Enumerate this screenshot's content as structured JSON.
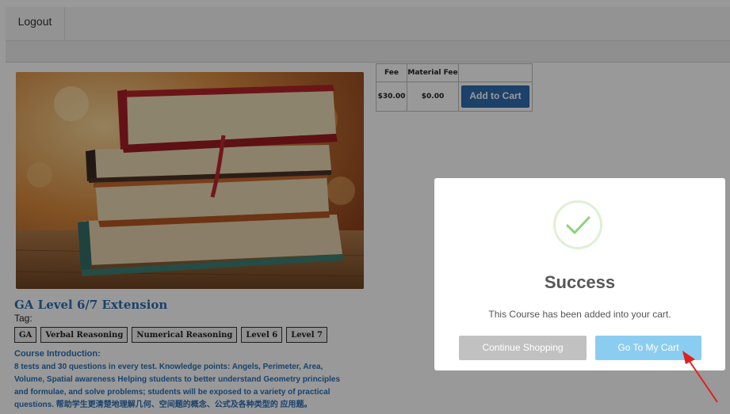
{
  "topbar": {
    "logout_label": "Logout"
  },
  "fee_table": {
    "headers": [
      "Fee",
      "Material Fee",
      ""
    ],
    "row": {
      "fee": "$30.00",
      "material_fee": "$0.00",
      "button_label": "Add to Cart"
    }
  },
  "course": {
    "title": "GA Level 6/7 Extension",
    "tag_label": "Tag:",
    "tags": [
      "GA",
      "Verbal Reasoning",
      "Numerical Reasoning",
      "Level 6",
      "Level 7"
    ],
    "intro_heading": "Course Introduction:",
    "intro_lines": [
      "8 tests and 30 questions in every test. Knowledge points: Angels, Perimeter, Area,",
      "Volume, Spatial awareness Helping students to better understand Geometry principles",
      "and formulae, and solve problems; students will be exposed to a variety of practical",
      "questions. 帮助学生更清楚地理解几何、空间题的概念、公式及各种类型的 应用题。"
    ]
  },
  "modal": {
    "title": "Success",
    "message": "This Course has been added into your cart.",
    "continue_label": "Continue Shopping",
    "cart_label": "Go To My Cart"
  },
  "icons": {
    "success": "checkmark-icon",
    "pointer": "red-arrow-icon"
  },
  "colors": {
    "accent_blue": "#2f6eb3",
    "link_blue": "#2a6fb5",
    "success_green": "#8cd37a",
    "cart_button": "#8bcdf0",
    "arrow_red": "#e02020"
  }
}
